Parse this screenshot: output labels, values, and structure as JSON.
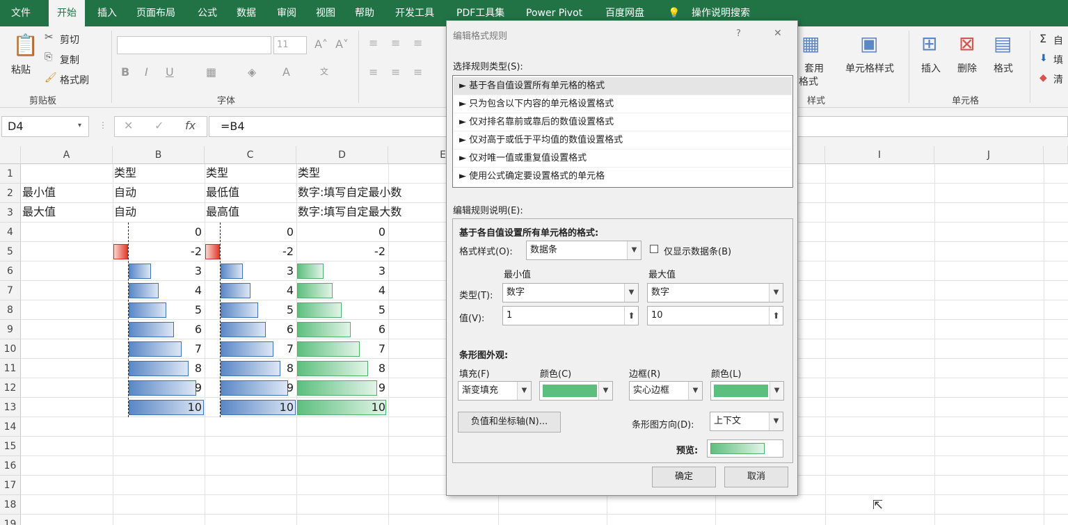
{
  "menu": {
    "tabs": [
      "文件",
      "开始",
      "插入",
      "页面布局",
      "公式",
      "数据",
      "审阅",
      "视图",
      "帮助",
      "开发工具",
      "PDF工具集",
      "Power Pivot",
      "百度网盘"
    ],
    "active": "开始",
    "search": "操作说明搜索"
  },
  "ribbon": {
    "clipboard": {
      "paste": "粘贴",
      "cut": "剪切",
      "copy": "复制",
      "format_painter": "格式刷",
      "group": "剪贴板"
    },
    "font": {
      "size": "11",
      "group": "字体"
    },
    "styles": {
      "table_format_1": "套用",
      "table_format_2": "格式",
      "cell_styles": "单元格样式",
      "group": "样式"
    },
    "cells": {
      "insert": "插入",
      "delete": "删除",
      "format": "格式",
      "group": "单元格"
    },
    "editing": {
      "autosum": "自",
      "fill": "填",
      "clear": "清"
    }
  },
  "formula_bar": {
    "name_box": "D4",
    "formula": "=B4"
  },
  "sheet": {
    "columns": [
      "A",
      "B",
      "C",
      "D",
      "E",
      "",
      "",
      "I",
      "J"
    ],
    "rows": [
      "1",
      "2",
      "3",
      "4",
      "5",
      "6",
      "7",
      "8",
      "9",
      "10",
      "11",
      "12",
      "13",
      "14",
      "15",
      "16",
      "17",
      "18",
      "19"
    ],
    "row1": {
      "B": "类型",
      "C": "类型",
      "D": "类型"
    },
    "row2": {
      "A": "最小值",
      "B": "自动",
      "C": "最低值",
      "D": "数字:填写自定最小数"
    },
    "row3": {
      "A": "最大值",
      "B": "自动",
      "C": "最高值",
      "D": "数字:填写自定最大数"
    },
    "values": [
      0,
      -2,
      3,
      4,
      5,
      6,
      7,
      8,
      9,
      10
    ]
  },
  "dialog": {
    "title": "编辑格式规则",
    "help": "?",
    "close": "✕",
    "select_rule_label": "选择规则类型(S):",
    "rules": [
      "► 基于各自值设置所有单元格的格式",
      "► 只为包含以下内容的单元格设置格式",
      "► 仅对排名靠前或靠后的数值设置格式",
      "► 仅对高于或低于平均值的数值设置格式",
      "► 仅对唯一值或重复值设置格式",
      "► 使用公式确定要设置格式的单元格"
    ],
    "edit_label": "编辑规则说明(E):",
    "desc_title": "基于各自值设置所有单元格的格式:",
    "format_style_label": "格式样式(O):",
    "format_style_value": "数据条",
    "show_bar_only": "仅显示数据条(B)",
    "min_label": "最小值",
    "max_label": "最大值",
    "type_label": "类型(T):",
    "min_type": "数字",
    "max_type": "数字",
    "value_label": "值(V):",
    "min_value": "1",
    "max_value": "10",
    "appearance_label": "条形图外观:",
    "fill_label": "填充(F)",
    "fill_value": "渐变填充",
    "fill_color_label": "颜色(C)",
    "border_label": "边框(R)",
    "border_value": "实心边框",
    "border_color_label": "颜色(L)",
    "neg_axis_button": "负值和坐标轴(N)...",
    "direction_label": "条形图方向(D):",
    "direction_value": "上下文",
    "preview_label": "预览:",
    "ok": "确定",
    "cancel": "取消",
    "bar_color": "#5dbf7e"
  }
}
